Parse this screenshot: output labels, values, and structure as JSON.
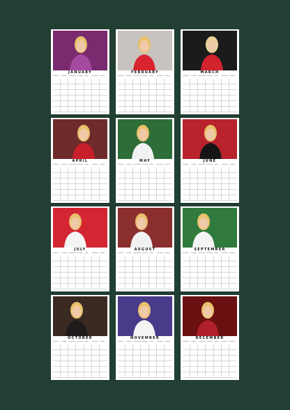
{
  "weekdays": [
    "Monday",
    "Tuesday",
    "Wednesday",
    "Thursday",
    "Friday",
    "Saturday",
    "Sunday"
  ],
  "months": [
    {
      "name": "JANUARY",
      "photo": {
        "bg": "#7a2a6e",
        "accent": "#e8c16a",
        "kit": "#a44aa0"
      }
    },
    {
      "name": "FEBRUARY",
      "photo": {
        "bg": "#c9c3bf",
        "accent": "#e8c16a",
        "kit": "#d9232f"
      }
    },
    {
      "name": "MARCH",
      "photo": {
        "bg": "#1b1b1b",
        "accent": "#e8d49a",
        "kit": "#d1232e"
      }
    },
    {
      "name": "APRIL",
      "photo": {
        "bg": "#6e2b2b",
        "accent": "#e8c16a",
        "kit": "#c91f2a"
      }
    },
    {
      "name": "MAY",
      "photo": {
        "bg": "#2e6d38",
        "accent": "#e8c16a",
        "kit": "#f2f2f2"
      }
    },
    {
      "name": "JUNE",
      "photo": {
        "bg": "#b8232d",
        "accent": "#e8c16a",
        "kit": "#151515"
      }
    },
    {
      "name": "JULY",
      "photo": {
        "bg": "#d42532",
        "accent": "#e8c16a",
        "kit": "#f4f4f4"
      }
    },
    {
      "name": "AUGUST",
      "photo": {
        "bg": "#8a2e2e",
        "accent": "#e8c16a",
        "kit": "#f1f1f1"
      }
    },
    {
      "name": "SEPTEMBER",
      "photo": {
        "bg": "#2f7a3c",
        "accent": "#e8c16a",
        "kit": "#f4f4f4"
      }
    },
    {
      "name": "OCTOBER",
      "photo": {
        "bg": "#3a2a22",
        "accent": "#e8c16a",
        "kit": "#1f1b1b"
      }
    },
    {
      "name": "NOVEMBER",
      "photo": {
        "bg": "#4a3a8a",
        "accent": "#e8c16a",
        "kit": "#f4f4f4"
      }
    },
    {
      "name": "DECEMBER",
      "photo": {
        "bg": "#6a1010",
        "accent": "#e8c16a",
        "kit": "#b0202a"
      }
    }
  ]
}
